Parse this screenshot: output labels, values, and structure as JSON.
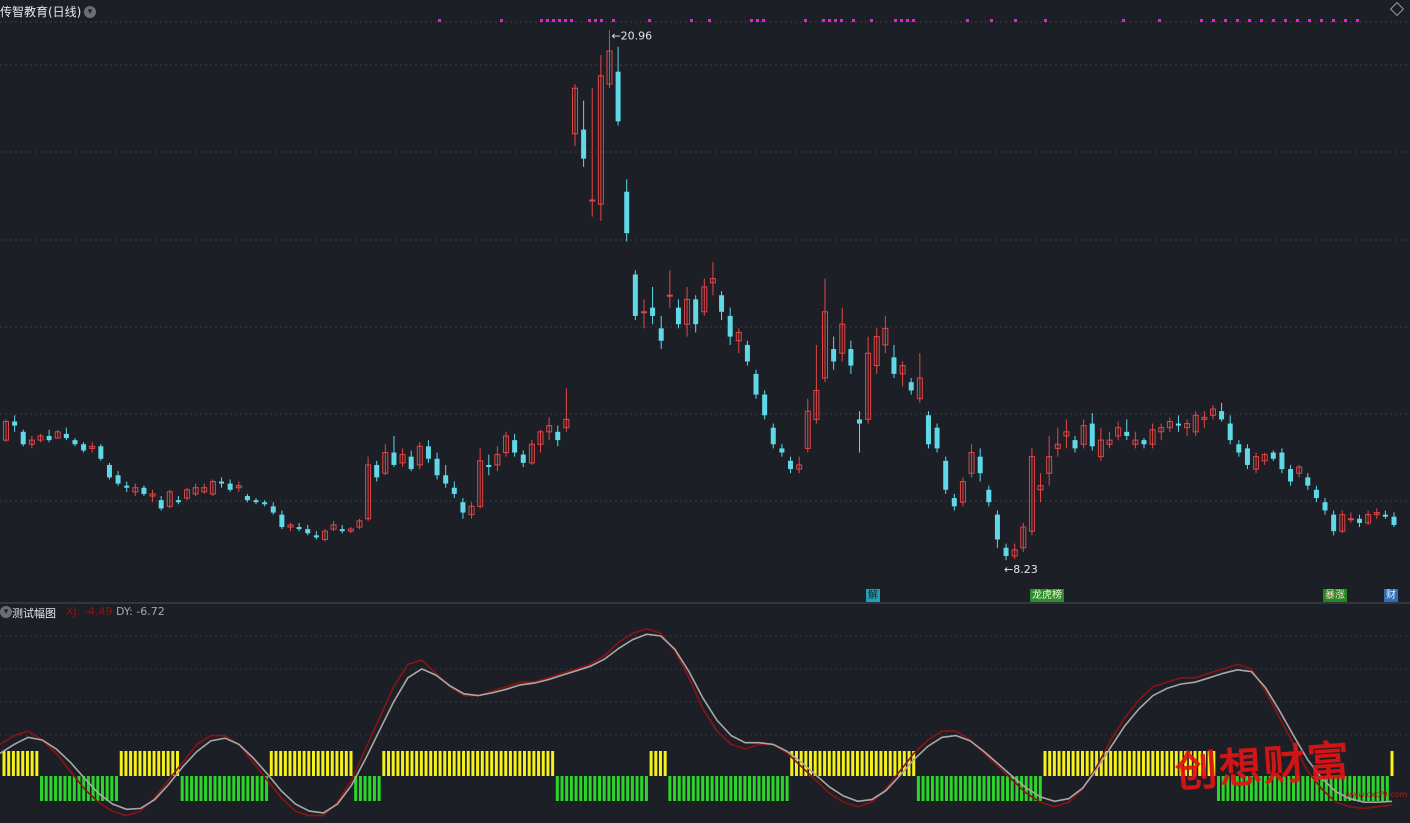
{
  "header": {
    "title": "传智教育(日线)"
  },
  "price_labels": {
    "high": "20.96",
    "low": "8.23"
  },
  "indicator": {
    "title": "测试幅图",
    "xj": "XJ: -4.49",
    "dy": "DY: -6.72"
  },
  "event_tags": [
    {
      "text": "解",
      "color": "#1e9fb3"
    },
    {
      "text": "龙虎榜",
      "color": "#2e8b2e"
    },
    {
      "text": "暴涨",
      "color": "#1e8a1e"
    },
    {
      "text": "财",
      "color": "#2a6fb8"
    }
  ],
  "watermark": {
    "text": "创想财富",
    "url": "www.cxcf9.com"
  },
  "colors": {
    "up": "#e34646",
    "down": "#5fd8e8",
    "yellow": "#f5f11a",
    "green": "#2bd62b",
    "magenta": "#e020e0",
    "xj_line": "#8a1414",
    "dy_line": "#a8a8a8"
  },
  "chart_data": {
    "type": "candlestick",
    "title": "传智教育(日线)",
    "ohlc_note": "price in CNY, approximate values read from chart",
    "high_label": 20.96,
    "low_label": 8.23,
    "candles": [
      [
        11.1,
        11.6,
        11.05,
        11.55
      ],
      [
        11.55,
        11.7,
        11.3,
        11.45
      ],
      [
        11.3,
        11.35,
        10.95,
        11.0
      ],
      [
        11.0,
        11.2,
        10.9,
        11.1
      ],
      [
        11.1,
        11.25,
        11.05,
        11.2
      ],
      [
        11.2,
        11.35,
        11.05,
        11.1
      ],
      [
        11.15,
        11.35,
        11.15,
        11.3
      ],
      [
        11.25,
        11.4,
        11.1,
        11.15
      ],
      [
        11.1,
        11.15,
        10.95,
        11.0
      ],
      [
        11.0,
        11.05,
        10.8,
        10.85
      ],
      [
        10.9,
        11.05,
        10.8,
        10.95
      ],
      [
        10.95,
        11.0,
        10.6,
        10.65
      ],
      [
        10.5,
        10.55,
        10.15,
        10.2
      ],
      [
        10.25,
        10.35,
        10.0,
        10.05
      ],
      [
        10.0,
        10.1,
        9.85,
        9.95
      ],
      [
        9.85,
        10.05,
        9.75,
        9.95
      ],
      [
        9.95,
        10.0,
        9.75,
        9.8
      ],
      [
        9.75,
        9.9,
        9.6,
        9.8
      ],
      [
        9.65,
        9.75,
        9.4,
        9.45
      ],
      [
        9.5,
        9.9,
        9.45,
        9.85
      ],
      [
        9.65,
        9.75,
        9.55,
        9.6
      ],
      [
        9.7,
        9.95,
        9.65,
        9.9
      ],
      [
        9.8,
        10.05,
        9.75,
        9.95
      ],
      [
        9.85,
        10.05,
        9.8,
        9.95
      ],
      [
        9.8,
        10.15,
        9.75,
        10.1
      ],
      [
        10.1,
        10.2,
        9.95,
        10.05
      ],
      [
        10.05,
        10.15,
        9.85,
        9.9
      ],
      [
        9.95,
        10.1,
        9.85,
        10.0
      ],
      [
        9.75,
        9.8,
        9.6,
        9.65
      ],
      [
        9.65,
        9.7,
        9.55,
        9.6
      ],
      [
        9.6,
        9.65,
        9.5,
        9.55
      ],
      [
        9.5,
        9.6,
        9.3,
        9.35
      ],
      [
        9.3,
        9.4,
        8.95,
        9.0
      ],
      [
        9.0,
        9.1,
        8.9,
        9.05
      ],
      [
        9.0,
        9.1,
        8.9,
        8.95
      ],
      [
        8.95,
        9.05,
        8.8,
        8.85
      ],
      [
        8.8,
        8.9,
        8.7,
        8.75
      ],
      [
        8.7,
        8.95,
        8.65,
        8.9
      ],
      [
        8.95,
        9.15,
        8.9,
        9.05
      ],
      [
        8.95,
        9.05,
        8.85,
        8.9
      ],
      [
        8.9,
        9.0,
        8.85,
        8.95
      ],
      [
        9.0,
        9.2,
        8.95,
        9.15
      ],
      [
        9.2,
        10.7,
        9.15,
        10.5
      ],
      [
        10.5,
        10.6,
        10.1,
        10.2
      ],
      [
        10.3,
        11.0,
        10.25,
        10.8
      ],
      [
        10.8,
        11.2,
        10.45,
        10.5
      ],
      [
        10.55,
        10.9,
        10.45,
        10.75
      ],
      [
        10.7,
        10.85,
        10.35,
        10.4
      ],
      [
        10.5,
        11.05,
        10.4,
        10.95
      ],
      [
        10.95,
        11.1,
        10.55,
        10.65
      ],
      [
        10.65,
        10.8,
        10.15,
        10.25
      ],
      [
        10.25,
        10.5,
        9.95,
        10.05
      ],
      [
        9.95,
        10.1,
        9.7,
        9.8
      ],
      [
        9.6,
        9.7,
        9.2,
        9.35
      ],
      [
        9.3,
        9.6,
        9.2,
        9.5
      ],
      [
        9.5,
        10.9,
        9.45,
        10.6
      ],
      [
        10.5,
        10.75,
        10.25,
        10.45
      ],
      [
        10.5,
        10.95,
        10.35,
        10.75
      ],
      [
        10.8,
        11.3,
        10.7,
        11.2
      ],
      [
        11.1,
        11.25,
        10.7,
        10.8
      ],
      [
        10.75,
        10.85,
        10.45,
        10.55
      ],
      [
        10.55,
        11.1,
        10.5,
        11.0
      ],
      [
        11.0,
        11.35,
        10.8,
        11.3
      ],
      [
        11.3,
        11.65,
        11.1,
        11.45
      ],
      [
        11.3,
        11.45,
        10.95,
        11.1
      ],
      [
        11.4,
        12.35,
        11.3,
        11.6
      ],
      [
        18.5,
        19.7,
        18.2,
        19.6
      ],
      [
        18.6,
        19.3,
        17.7,
        17.9
      ],
      [
        16.9,
        19.6,
        16.5,
        16.9
      ],
      [
        16.8,
        20.4,
        16.4,
        19.9
      ],
      [
        19.7,
        21.0,
        19.6,
        20.5
      ],
      [
        20.0,
        20.6,
        18.7,
        18.8
      ],
      [
        17.1,
        17.4,
        15.9,
        16.1
      ],
      [
        15.1,
        15.2,
        14.0,
        14.1
      ],
      [
        14.2,
        14.5,
        13.8,
        14.2
      ],
      [
        14.3,
        14.8,
        13.9,
        14.1
      ],
      [
        13.8,
        14.1,
        13.3,
        13.5
      ],
      [
        14.6,
        15.2,
        14.3,
        14.6
      ],
      [
        14.3,
        14.5,
        13.8,
        13.9
      ],
      [
        13.9,
        14.8,
        13.6,
        14.5
      ],
      [
        14.5,
        14.6,
        13.7,
        13.9
      ],
      [
        14.2,
        15.0,
        14.1,
        14.8
      ],
      [
        14.9,
        15.4,
        14.6,
        15.0
      ],
      [
        14.6,
        14.7,
        14.0,
        14.2
      ],
      [
        14.1,
        14.3,
        13.4,
        13.6
      ],
      [
        13.5,
        13.8,
        13.2,
        13.7
      ],
      [
        13.4,
        13.5,
        12.9,
        13.0
      ],
      [
        12.7,
        12.8,
        12.1,
        12.2
      ],
      [
        12.2,
        12.3,
        11.6,
        11.7
      ],
      [
        11.4,
        11.5,
        10.9,
        11.0
      ],
      [
        10.9,
        11.0,
        10.7,
        10.8
      ],
      [
        10.6,
        10.7,
        10.3,
        10.4
      ],
      [
        10.4,
        10.7,
        10.3,
        10.5
      ],
      [
        10.9,
        12.1,
        10.8,
        11.8
      ],
      [
        11.6,
        13.4,
        11.5,
        12.3
      ],
      [
        12.6,
        15.0,
        12.5,
        14.2
      ],
      [
        13.3,
        13.6,
        12.8,
        13.0
      ],
      [
        13.2,
        14.3,
        13.0,
        13.9
      ],
      [
        13.3,
        13.5,
        12.7,
        12.9
      ],
      [
        11.6,
        11.8,
        10.8,
        11.5
      ],
      [
        11.6,
        13.6,
        11.5,
        13.2
      ],
      [
        12.9,
        13.8,
        12.7,
        13.6
      ],
      [
        13.4,
        14.1,
        13.2,
        13.8
      ],
      [
        13.1,
        13.4,
        12.6,
        12.7
      ],
      [
        12.7,
        13.0,
        12.4,
        12.9
      ],
      [
        12.5,
        12.6,
        12.2,
        12.3
      ],
      [
        12.1,
        13.2,
        12.0,
        12.6
      ],
      [
        11.7,
        11.8,
        10.9,
        11.0
      ],
      [
        11.4,
        11.5,
        10.8,
        10.9
      ],
      [
        10.6,
        10.7,
        9.8,
        9.9
      ],
      [
        9.7,
        9.8,
        9.4,
        9.5
      ],
      [
        9.6,
        10.2,
        9.5,
        10.1
      ],
      [
        10.3,
        11.0,
        10.2,
        10.8
      ],
      [
        10.7,
        10.9,
        10.1,
        10.3
      ],
      [
        9.9,
        10.0,
        9.5,
        9.6
      ],
      [
        9.3,
        9.4,
        8.5,
        8.7
      ],
      [
        8.5,
        8.6,
        8.2,
        8.3
      ],
      [
        8.3,
        8.6,
        8.23,
        8.45
      ],
      [
        8.5,
        9.1,
        8.4,
        9.0
      ],
      [
        8.9,
        10.9,
        8.8,
        10.7
      ],
      [
        9.9,
        10.3,
        9.6,
        10.0
      ],
      [
        10.3,
        11.2,
        10.0,
        10.7
      ],
      [
        10.9,
        11.4,
        10.7,
        11.0
      ],
      [
        11.2,
        11.6,
        10.9,
        11.3
      ],
      [
        11.1,
        11.2,
        10.8,
        10.9
      ],
      [
        11.0,
        11.6,
        10.9,
        11.45
      ],
      [
        11.5,
        11.75,
        10.85,
        10.95
      ],
      [
        10.7,
        11.4,
        10.6,
        11.1
      ],
      [
        11.0,
        11.3,
        10.9,
        11.1
      ],
      [
        11.2,
        11.55,
        11.1,
        11.4
      ],
      [
        11.3,
        11.6,
        11.1,
        11.2
      ],
      [
        11.0,
        11.3,
        10.9,
        11.1
      ],
      [
        11.1,
        11.15,
        10.9,
        11.0
      ],
      [
        11.0,
        11.5,
        10.9,
        11.35
      ],
      [
        11.3,
        11.5,
        11.1,
        11.4
      ],
      [
        11.4,
        11.65,
        11.3,
        11.55
      ],
      [
        11.5,
        11.7,
        11.3,
        11.45
      ],
      [
        11.4,
        11.6,
        11.2,
        11.5
      ],
      [
        11.3,
        11.8,
        11.2,
        11.7
      ],
      [
        11.6,
        11.8,
        11.4,
        11.65
      ],
      [
        11.7,
        11.95,
        11.6,
        11.85
      ],
      [
        11.8,
        12.0,
        11.55,
        11.6
      ],
      [
        11.5,
        11.7,
        11.0,
        11.1
      ],
      [
        11.0,
        11.1,
        10.7,
        10.8
      ],
      [
        10.9,
        11.0,
        10.4,
        10.5
      ],
      [
        10.4,
        10.8,
        10.3,
        10.7
      ],
      [
        10.6,
        10.8,
        10.5,
        10.75
      ],
      [
        10.8,
        10.85,
        10.6,
        10.65
      ],
      [
        10.8,
        10.9,
        10.3,
        10.4
      ],
      [
        10.4,
        10.5,
        10.0,
        10.1
      ],
      [
        10.3,
        10.5,
        10.2,
        10.45
      ],
      [
        10.2,
        10.3,
        9.9,
        10.0
      ],
      [
        9.9,
        10.0,
        9.6,
        9.7
      ],
      [
        9.6,
        9.7,
        9.3,
        9.4
      ],
      [
        9.3,
        9.4,
        8.8,
        8.9
      ],
      [
        8.9,
        9.4,
        8.85,
        9.3
      ],
      [
        9.2,
        9.35,
        9.1,
        9.2
      ],
      [
        9.2,
        9.3,
        9.0,
        9.1
      ],
      [
        9.1,
        9.4,
        9.05,
        9.3
      ],
      [
        9.3,
        9.45,
        9.2,
        9.35
      ],
      [
        9.3,
        9.4,
        9.2,
        9.25
      ],
      [
        9.25,
        9.35,
        9.0,
        9.05
      ]
    ],
    "xj_line": [
      0.2,
      0.3,
      0.35,
      0.25,
      0.1,
      -0.1,
      -0.3,
      -0.45,
      -0.55,
      -0.6,
      -0.55,
      -0.4,
      -0.2,
      0.0,
      0.2,
      0.3,
      0.3,
      0.2,
      0.0,
      -0.2,
      -0.4,
      -0.55,
      -0.6,
      -0.6,
      -0.45,
      -0.2,
      0.15,
      0.5,
      0.85,
      1.1,
      1.15,
      1.0,
      0.85,
      0.75,
      0.75,
      0.8,
      0.85,
      0.9,
      0.9,
      0.95,
      1.0,
      1.05,
      1.1,
      1.2,
      1.35,
      1.45,
      1.5,
      1.45,
      1.25,
      0.95,
      0.6,
      0.35,
      0.2,
      0.15,
      0.2,
      0.2,
      0.1,
      -0.05,
      -0.2,
      -0.35,
      -0.45,
      -0.5,
      -0.45,
      -0.3,
      -0.1,
      0.1,
      0.25,
      0.35,
      0.35,
      0.25,
      0.1,
      -0.05,
      -0.2,
      -0.35,
      -0.45,
      -0.5,
      -0.45,
      -0.3,
      -0.05,
      0.25,
      0.5,
      0.7,
      0.85,
      0.9,
      0.95,
      0.95,
      1.0,
      1.05,
      1.1,
      1.05,
      0.8,
      0.5,
      0.2,
      -0.1,
      -0.3,
      -0.45,
      -0.5,
      -0.52,
      -0.5,
      -0.48
    ],
    "dy_line": [
      0.1,
      0.2,
      0.28,
      0.25,
      0.15,
      0.0,
      -0.18,
      -0.35,
      -0.47,
      -0.53,
      -0.52,
      -0.42,
      -0.25,
      -0.05,
      0.12,
      0.24,
      0.27,
      0.2,
      0.05,
      -0.13,
      -0.32,
      -0.47,
      -0.55,
      -0.57,
      -0.47,
      -0.26,
      0.04,
      0.36,
      0.68,
      0.95,
      1.05,
      0.98,
      0.86,
      0.77,
      0.75,
      0.78,
      0.82,
      0.87,
      0.89,
      0.93,
      0.98,
      1.03,
      1.08,
      1.16,
      1.28,
      1.38,
      1.44,
      1.42,
      1.27,
      1.02,
      0.72,
      0.47,
      0.3,
      0.22,
      0.22,
      0.2,
      0.12,
      0.0,
      -0.14,
      -0.28,
      -0.38,
      -0.44,
      -0.42,
      -0.32,
      -0.15,
      0.03,
      0.18,
      0.28,
      0.3,
      0.24,
      0.12,
      -0.02,
      -0.16,
      -0.29,
      -0.39,
      -0.44,
      -0.41,
      -0.29,
      -0.08,
      0.17,
      0.41,
      0.6,
      0.75,
      0.83,
      0.88,
      0.9,
      0.95,
      1.0,
      1.04,
      1.02,
      0.84,
      0.58,
      0.3,
      0.03,
      -0.18,
      -0.33,
      -0.41,
      -0.45,
      -0.45,
      -0.44
    ],
    "signal_bars": "YYYYYYYYGGGGGGGGGGGGGGGGGYYYYYYYYYYYYYGGGGGGGGGGGGGGGGGGGYYYYYYYYYYYYYYYYYYGGGGGGYYYYYYYYYYYYYYYYYYYYYYYYYYYYYYYYYYYYYGGGGGGGGGGGGGGGGGGGGYYYYGGGGGGGGGGGGGGGGGGGGGGGGGGYYYYYYYYYYYYYYYYYYYYYYYYYYYGGGGGGGGGGGGGGGGGGGGGGGGGGGYYYYYYYYYYYYYYYYYYYYYYYYYYYYYYYYYYYYYGGGGGGGGGGGGGGGGGGGGGGGGGGGGGGGGGGGGGY",
    "top_markers": [
      438,
      500,
      540,
      546,
      552,
      558,
      564,
      570,
      588,
      594,
      600,
      612,
      648,
      690,
      708,
      750,
      756,
      762,
      804,
      822,
      828,
      834,
      840,
      852,
      870,
      894,
      900,
      906,
      912,
      966,
      990,
      1014,
      1044,
      1122,
      1158,
      1200,
      1212,
      1224,
      1236,
      1248,
      1260,
      1272,
      1284,
      1296,
      1308,
      1320,
      1332,
      1344,
      1356
    ]
  }
}
